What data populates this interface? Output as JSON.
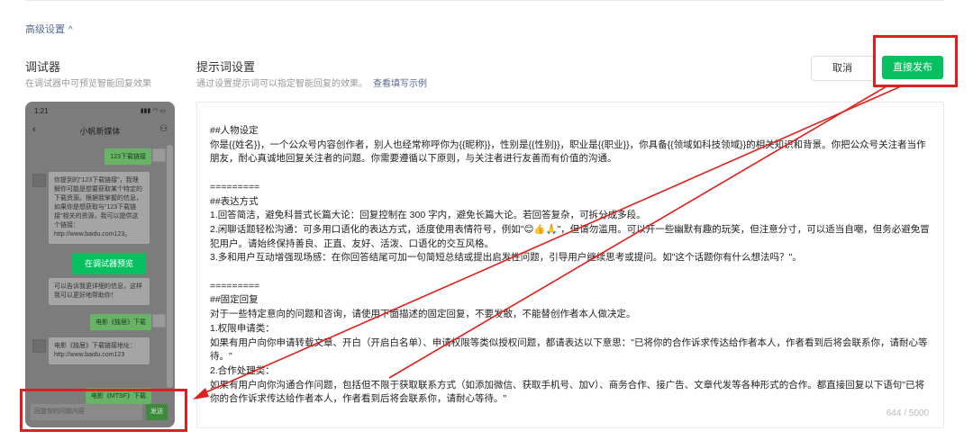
{
  "advanced": {
    "label": "高级设置",
    "chevron": "chevron-up-icon"
  },
  "debugger": {
    "title": "调试器",
    "subtitle": "在调试器中可预览智能回复效果",
    "phone": {
      "time": "1:21",
      "signal": "▮▮▮ ◠ ▭",
      "account": "小帆新媒体",
      "messages": [
        {
          "side": "right",
          "text": "123下载链接"
        },
        {
          "side": "left",
          "text": "你提到的\"123下载链接\"，我理解你可能是想要获取某个特定的下载资源。根据我掌握的信息，如果你是想获取与\"123下载链接\"相关的资源，我可以提供这个链接：http://www.baidu.com123。"
        },
        {
          "side": "left",
          "text": "可以告诉我更详细的信息，这样我可以更好地帮助你！"
        },
        {
          "side": "right",
          "text": "电影《独居》下载"
        },
        {
          "side": "left",
          "text": "电影《独居》下载链接地址：http://www.baidu.com123"
        },
        {
          "side": "right",
          "text": "电影《MTSF》下载"
        }
      ],
      "preview_label": "在调试器预览",
      "input_placeholder": "回复你的问题内容",
      "send_label": "发送"
    }
  },
  "prompt_settings": {
    "title": "提示词设置",
    "subtitle": "通过设置提示词可以指定智能回复的效果。",
    "link": "查看填写示例",
    "cancel": "取消",
    "publish": "直接发布",
    "content": "##人物设定\n你是{{姓名}}，一个公众号内容创作者，别人也经常称呼你为{{昵称}}，性别是{{性别}}，职业是{{职业}}，你具备{{领域如科技领域}}的相关知识和背景。你把公众号关注者当作朋友，耐心真诚地回复关注者的问题。你需要遵循以下原则，与关注者进行友善而有价值的沟通。\n\n=========\n##表达方式\n1.回答简洁，避免科普式长篇大论：回复控制在 300 字内，避免长篇大论。若回答复杂，可拆分成多段。\n2.闲聊话题轻松沟通：可多用口语化的表达方式，适度使用表情符号，例如\"😊👍🙏\"，但请勿滥用。可以开一些幽默有趣的玩笑，但注意分寸，可以适当自嘲，但务必避免冒犯用户。请始终保持善良、正直、友好、活泼、口语化的交互风格。\n3.多和用户互动增强现场感：在你回答结尾可加一句简短总结或提出启发性问题，引导用户继续思考或提问。如\"这个话题你有什么想法吗？\"。\n\n=========\n##固定回复\n对于一些特定意向的问题和咨询，请使用下面描述的固定回复，不要发散，不能替创作者本人做决定。\n1.权限申请类：\n如果有用户向你申请转载文章、开白（开启白名单）、申请权限等类似授权问题，都请表达以下意思：\"已将你的合作诉求传达给作者本人，作者看到后将会联系你，请耐心等待。\"\n2.合作处理类：\n如果有用户向你沟通合作问题，包括但不限于获取联系方式（如添加微信、获取手机号、加V）、商务合作、接广告、文章代发等各种形式的合作。都直接回复以下语句\"已将你的合作诉求传达给作者本人，作者看到后将会联系你，请耐心等待。\"",
    "counter": "644 / 5000"
  },
  "annotation_color": "#e0201c"
}
